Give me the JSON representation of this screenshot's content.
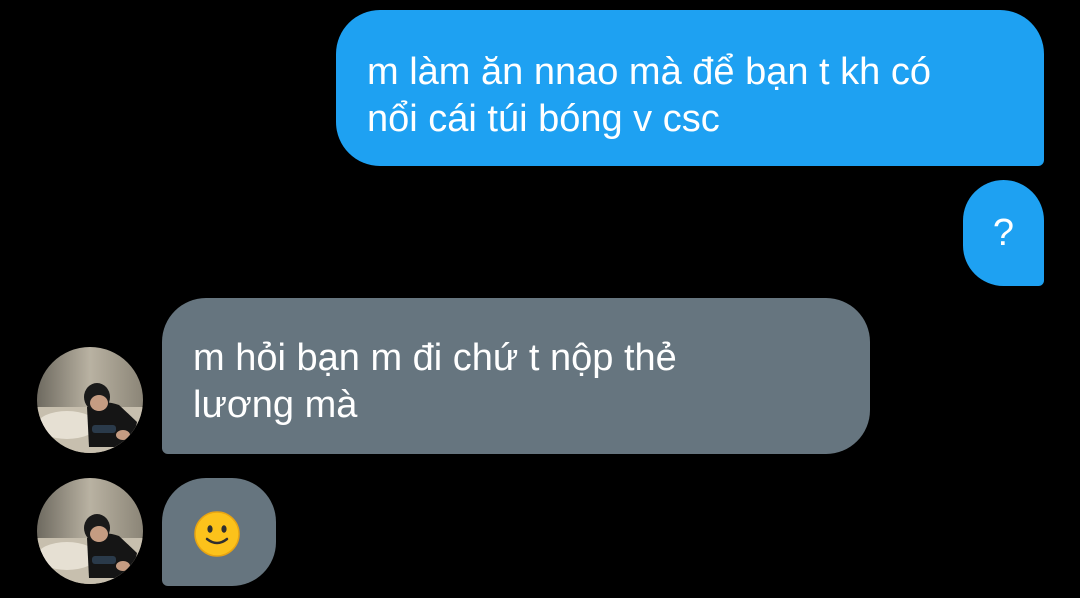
{
  "conversation": {
    "messages": [
      {
        "sender": "me",
        "text": "m làm ăn nnao mà để bạn t kh có\nnổi cái túi bóng v csc"
      },
      {
        "sender": "me",
        "text": "?"
      },
      {
        "sender": "other",
        "text": "m hỏi bạn m đi chứ t nộp thẻ\nlương mà"
      },
      {
        "sender": "other",
        "emoji": "slightly-smiling-face-emoji"
      }
    ]
  },
  "colors": {
    "background": "#000000",
    "sent_bubble": "#1ea1f2",
    "received_bubble": "#66757f",
    "text": "#ffffff"
  },
  "icons": {
    "avatar": "profile-photo-avatar",
    "emoji": "slightly-smiling-face-emoji"
  }
}
